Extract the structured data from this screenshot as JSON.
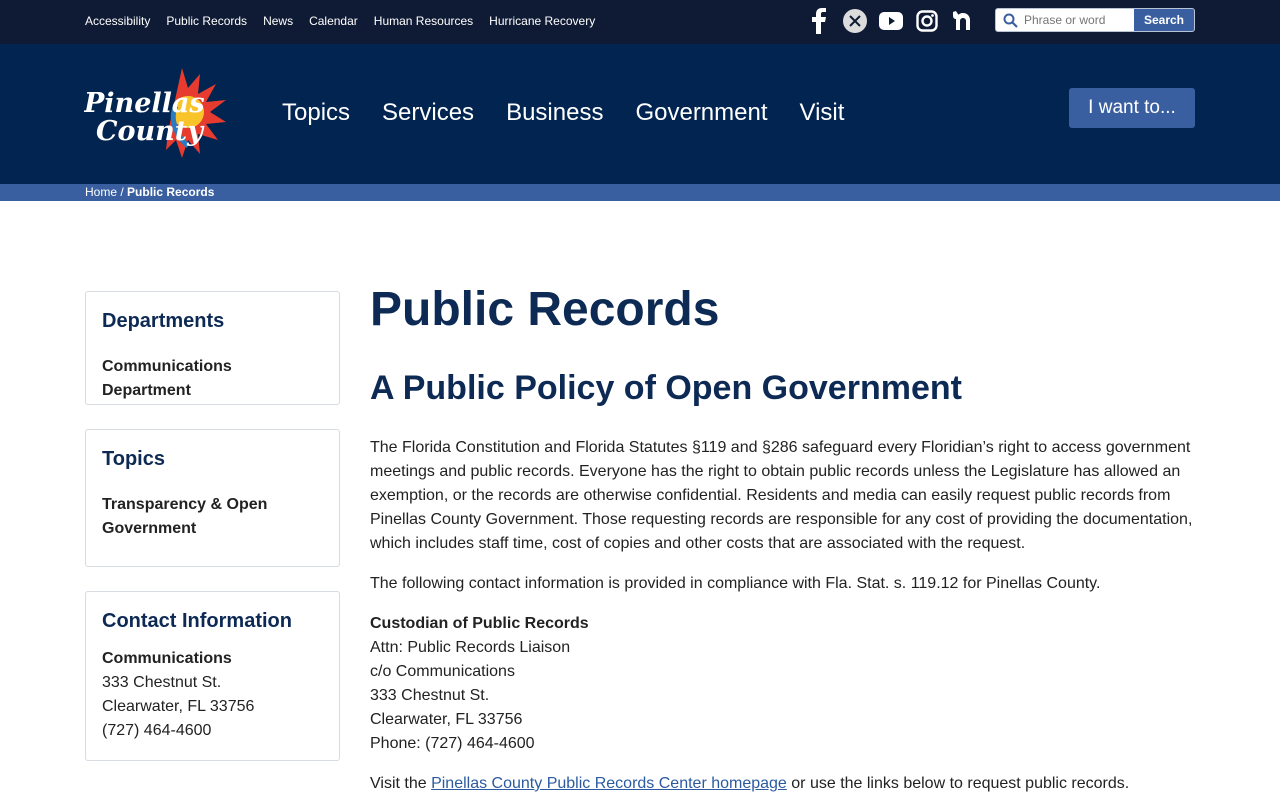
{
  "utility": {
    "links": [
      "Accessibility",
      "Public Records",
      "News",
      "Calendar",
      "Human Resources",
      "Hurricane Recovery"
    ],
    "social": [
      "facebook-icon",
      "x-icon",
      "youtube-icon",
      "instagram-icon",
      "nextdoor-icon"
    ],
    "search_placeholder": "Phrase or word",
    "search_button": "Search"
  },
  "header": {
    "nav": [
      "Topics",
      "Services",
      "Business",
      "Government",
      "Visit"
    ],
    "cta": "I want to...",
    "logo_line1": "Pinellas",
    "logo_line2": "County"
  },
  "breadcrumb": {
    "home": "Home",
    "separator": " / ",
    "current": "Public Records"
  },
  "sidebar": {
    "departments": {
      "title": "Departments",
      "link": "Communications Department"
    },
    "topics": {
      "title": "Topics",
      "link": "Transparency & Open Government"
    },
    "contact": {
      "title": "Contact Information",
      "name": "Communications",
      "address1": "333 Chestnut St.",
      "address2": "Clearwater, FL 33756",
      "phone": "(727) 464-4600"
    }
  },
  "main": {
    "title": "Public Records",
    "subtitle": "A Public Policy of Open Government",
    "intro": "The Florida Constitution and Florida Statutes §119 and §286 safeguard every Floridian’s right to access government meetings and public records. Everyone has the right to obtain public records unless the Legislature has allowed an exemption, or the records are otherwise confidential. Residents and media can easily request public records from Pinellas County Government. Those requesting records are responsible for any cost of providing the documentation, which includes staff time, cost of copies and other costs that are associated with the request.",
    "compliance": "The following contact information is provided in compliance with Fla. Stat. s. 119.12 for Pinellas County.",
    "custodian": {
      "title": "Custodian of Public Records",
      "line1": "Attn: Public Records Liaison",
      "line2": "c/o Communications",
      "line3": "333 Chestnut St.",
      "line4": "Clearwater, FL 33756",
      "line5": "Phone: (727) 464-4600"
    },
    "visit_prefix": "Visit the ",
    "visit_link": "Pinellas County Public Records Center homepage",
    "visit_suffix": " or use the links below to request public records."
  },
  "colors": {
    "utility_bg": "#0f1b34",
    "header_bg": "#022451",
    "accent": "#3a5fa0",
    "heading": "#0d2a55"
  }
}
